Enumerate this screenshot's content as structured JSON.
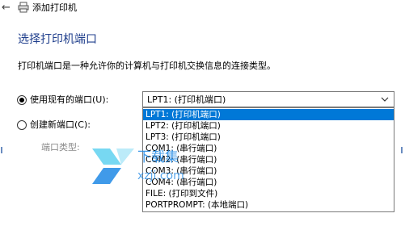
{
  "window": {
    "title": "添加打印机"
  },
  "page": {
    "heading": "选择打印机端口",
    "description": "打印机端口是一种允许你的计算机与打印机交换信息的连接类型。"
  },
  "options": {
    "use_existing": {
      "label": "使用现有的端口(U):",
      "checked": true
    },
    "create_new": {
      "label": "创建新端口(C):",
      "checked": false
    },
    "port_type_label": "端口类型:"
  },
  "port_select": {
    "selected": "LPT1: (打印机端口)",
    "items": [
      {
        "label": "LPT1: (打印机端口)",
        "highlighted": true
      },
      {
        "label": "LPT2: (打印机端口)"
      },
      {
        "label": "LPT3: (打印机端口)"
      },
      {
        "label": "COM1: (串行端口)"
      },
      {
        "label": "COM2: (串行端口)"
      },
      {
        "label": "COM3: (串行端口)"
      },
      {
        "label": "COM4: (串行端口)"
      },
      {
        "label": "FILE: (打印到文件)"
      },
      {
        "label": "PORTPROMPT: (本地端口)"
      }
    ]
  },
  "watermark": {
    "text_top": "下载集",
    "text_bottom": "xzji.com"
  },
  "colors": {
    "accent": "#0078d7",
    "heading": "#1f3e8c",
    "watermark_blue": "#1e88e5"
  },
  "icons": {
    "back": "back-arrow-icon",
    "printer": "printer-icon",
    "dropdown": "chevron-down-icon"
  }
}
